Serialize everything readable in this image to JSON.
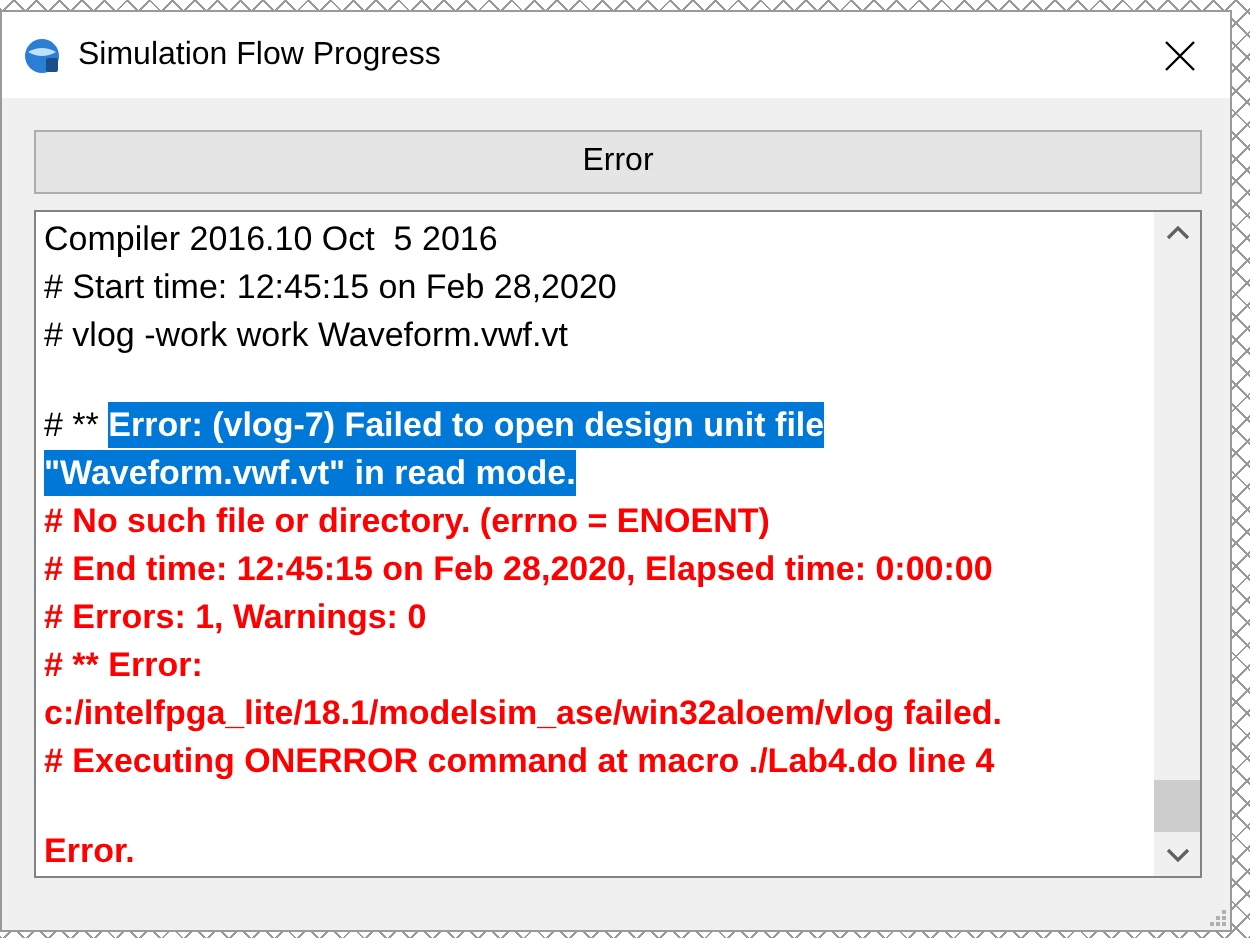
{
  "window": {
    "title": "Simulation Flow Progress"
  },
  "status_bar": {
    "label": "Error"
  },
  "log": [
    {
      "kind": "text",
      "segments": [
        {
          "kind": "plain",
          "text": "Compiler 2016.10 Oct  5 2016"
        }
      ]
    },
    {
      "kind": "text",
      "segments": [
        {
          "kind": "plain",
          "text": "# Start time: 12:45:15 on Feb 28,2020"
        }
      ]
    },
    {
      "kind": "text",
      "segments": [
        {
          "kind": "plain",
          "text": "# vlog -work work Waveform.vwf.vt"
        }
      ]
    },
    {
      "kind": "blank"
    },
    {
      "kind": "text",
      "segments": [
        {
          "kind": "plain",
          "text": "# ** "
        },
        {
          "kind": "selected",
          "text": "Error: (vlog-7) Failed to open design unit file"
        }
      ]
    },
    {
      "kind": "text",
      "segments": [
        {
          "kind": "selected",
          "text": "\"Waveform.vwf.vt\" in read mode."
        }
      ]
    },
    {
      "kind": "text",
      "segments": [
        {
          "kind": "error",
          "text": "# No such file or directory. (errno = ENOENT)"
        }
      ]
    },
    {
      "kind": "text",
      "segments": [
        {
          "kind": "error",
          "text": "# End time: 12:45:15 on Feb 28,2020, Elapsed time: 0:00:00"
        }
      ]
    },
    {
      "kind": "text",
      "segments": [
        {
          "kind": "error",
          "text": "# Errors: 1, Warnings: 0"
        }
      ]
    },
    {
      "kind": "text",
      "segments": [
        {
          "kind": "error",
          "text": "# ** Error:"
        }
      ]
    },
    {
      "kind": "text",
      "segments": [
        {
          "kind": "error",
          "text": "c:/intelfpga_lite/18.1/modelsim_ase/win32aloem/vlog failed."
        }
      ]
    },
    {
      "kind": "text",
      "segments": [
        {
          "kind": "error",
          "text": "# Executing ONERROR command at macro ./Lab4.do line 4"
        }
      ]
    },
    {
      "kind": "blank"
    },
    {
      "kind": "text",
      "segments": [
        {
          "kind": "error",
          "text": "Error."
        }
      ]
    }
  ]
}
